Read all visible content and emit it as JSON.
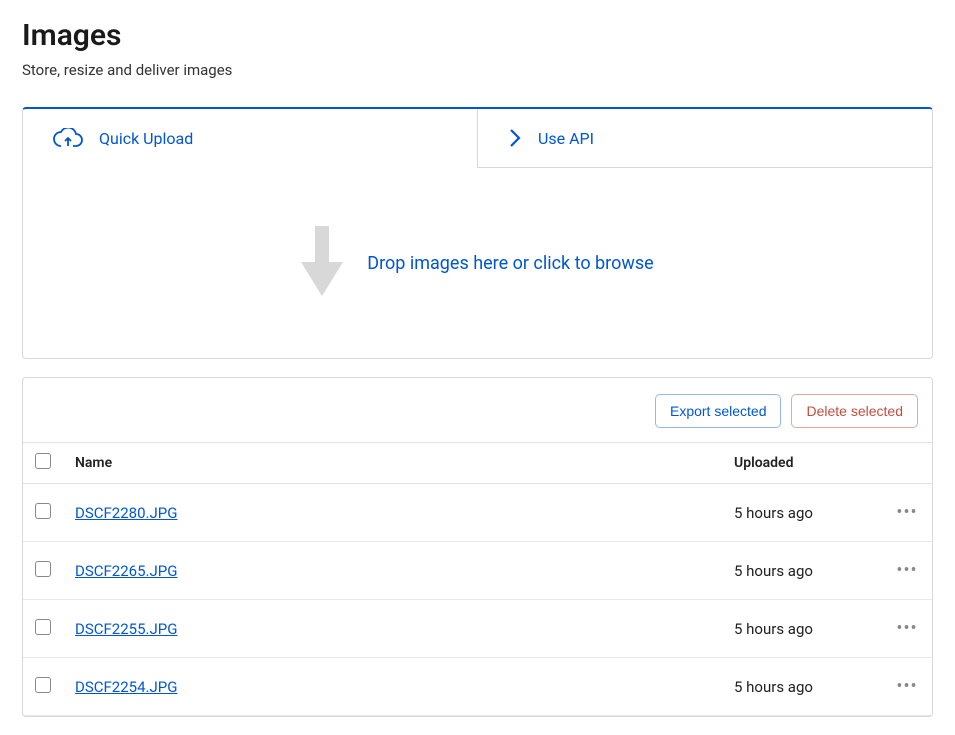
{
  "header": {
    "title": "Images",
    "subtitle": "Store, resize and deliver images"
  },
  "tabs": {
    "quick_upload": "Quick Upload",
    "use_api": "Use API"
  },
  "dropzone": {
    "text": "Drop images here or click to browse"
  },
  "toolbar": {
    "export_label": "Export selected",
    "delete_label": "Delete selected"
  },
  "table": {
    "columns": {
      "name": "Name",
      "uploaded": "Uploaded"
    },
    "rows": [
      {
        "name": "DSCF2280.JPG",
        "uploaded": "5 hours ago"
      },
      {
        "name": "DSCF2265.JPG",
        "uploaded": "5 hours ago"
      },
      {
        "name": "DSCF2255.JPG",
        "uploaded": "5 hours ago"
      },
      {
        "name": "DSCF2254.JPG",
        "uploaded": "5 hours ago"
      }
    ]
  }
}
